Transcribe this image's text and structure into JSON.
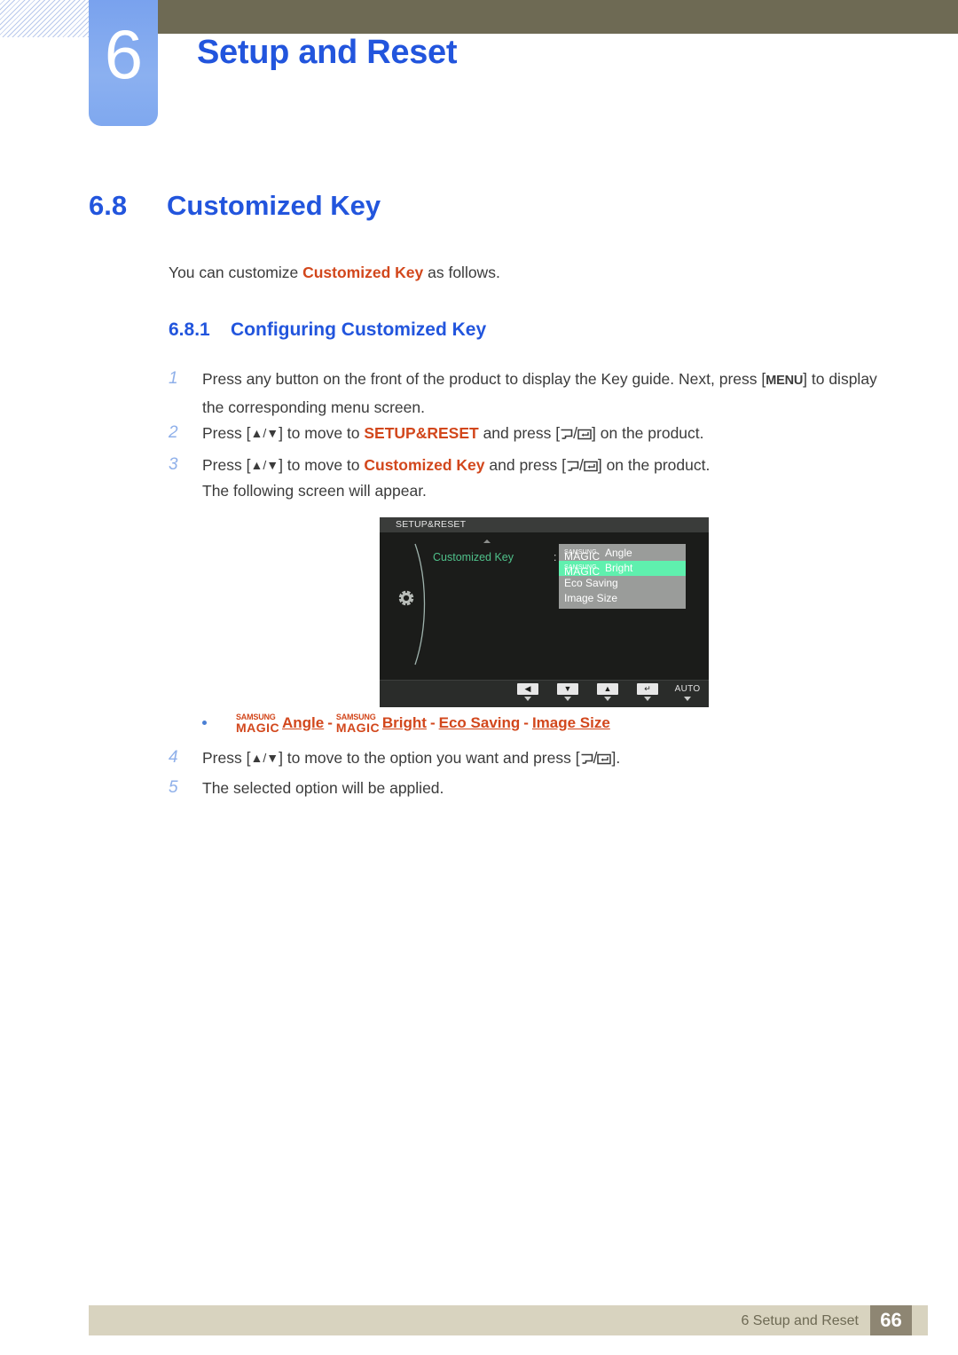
{
  "header": {
    "chapter_number": "6",
    "chapter_title": "Setup and Reset"
  },
  "section": {
    "number": "6.8",
    "title": "Customized Key",
    "intro_before": "You can customize ",
    "intro_highlight": "Customized Key",
    "intro_after": " as follows.",
    "subsection_number": "6.8.1",
    "subsection_title": "Configuring Customized Key"
  },
  "steps": [
    {
      "n": "1",
      "line1_a": "Press any button on the front of the product to display the Key guide. Next, press [",
      "menu_key": "MENU",
      "line1_b": "] to display",
      "line2": "the corresponding menu screen."
    },
    {
      "n": "2",
      "a": "Press [",
      "arrows": "▲/▼",
      "b": "] to move to ",
      "highlight": "SETUP&RESET",
      "c": " and press [",
      "d": "] on the product."
    },
    {
      "n": "3",
      "a": "Press [",
      "arrows": "▲/▼",
      "b": "] to move to ",
      "highlight": "Customized Key",
      "c": " and press [",
      "d": "] on the product."
    },
    {
      "n": "4",
      "a": "Press [",
      "arrows": "▲/▼",
      "b": "] to move to the option you want and press [",
      "d": "]."
    },
    {
      "n": "5",
      "a": "The selected option will be applied."
    }
  ],
  "step3_note": "The following screen will appear.",
  "osd": {
    "title": "SETUP&RESET",
    "label": "Customized Key",
    "colon": ":",
    "items": [
      {
        "prefix_top": "SAMSUNG",
        "prefix_bottom": "MAGIC",
        "label": "Angle",
        "selected": false
      },
      {
        "prefix_top": "SAMSUNG",
        "prefix_bottom": "MAGIC",
        "label": "Bright",
        "selected": true
      },
      {
        "prefix_top": "",
        "prefix_bottom": "",
        "label": "Eco Saving",
        "selected": false
      },
      {
        "prefix_top": "",
        "prefix_bottom": "",
        "label": "Image Size",
        "selected": false
      }
    ],
    "buttons": [
      {
        "glyph": "◀",
        "type": "icon"
      },
      {
        "glyph": "▼",
        "type": "icon"
      },
      {
        "glyph": "▲",
        "type": "icon"
      },
      {
        "glyph": "↵",
        "type": "icon"
      },
      {
        "glyph": "AUTO",
        "type": "text"
      },
      {
        "glyph": "⏻",
        "type": "text"
      }
    ],
    "colors": {
      "background": "#1b1c1a",
      "titlebar": "#3a3c3a",
      "label_green": "#4fc08a",
      "list_background": "#9a9c9a",
      "highlight_green": "#5ff0ae"
    }
  },
  "bullet": {
    "items": [
      {
        "prefix_top": "SAMSUNG",
        "prefix_bottom": "MAGIC",
        "label": "Angle"
      },
      {
        "prefix_top": "SAMSUNG",
        "prefix_bottom": "MAGIC",
        "label": "Bright"
      },
      {
        "prefix_top": "",
        "prefix_bottom": "",
        "label": "Eco Saving"
      },
      {
        "prefix_top": "",
        "prefix_bottom": "",
        "label": "Image Size"
      }
    ],
    "separator": "-"
  },
  "footer": {
    "text": "6 Setup and Reset",
    "page": "66"
  },
  "colors": {
    "heading_blue": "#2255dd",
    "highlight_red": "#d2471c",
    "header_bar": "#6e6a54",
    "tab_blue": "#7fa8ef",
    "footer_bar": "#d8d3bf",
    "footer_page_box": "#8e8673"
  }
}
